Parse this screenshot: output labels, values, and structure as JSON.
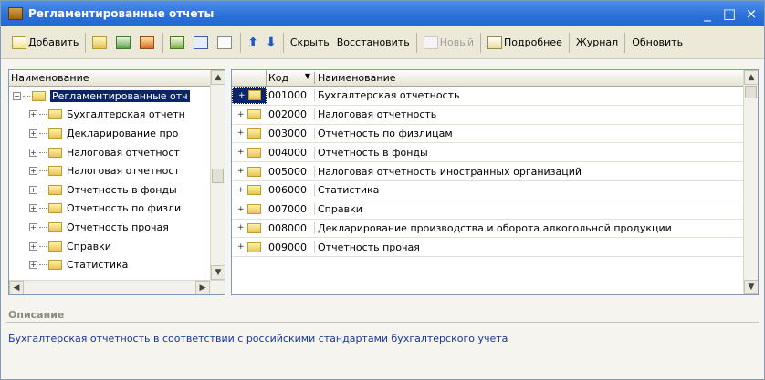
{
  "window": {
    "title": "Регламентированные отчеты",
    "min": "_",
    "max": "□",
    "close": "×"
  },
  "toolbar": {
    "add": "Добавить",
    "hide": "Скрыть",
    "restore": "Восстановить",
    "new": "Новый",
    "details": "Подробнее",
    "journal": "Журнал",
    "refresh": "Обновить"
  },
  "tree": {
    "header": "Наименование",
    "root": "Регламентированные отч",
    "items": [
      "Бухгалтерская отчетн",
      "Декларирование про",
      "Налоговая отчетност",
      "Налоговая отчетност",
      "Отчетность в фонды",
      "Отчетность по физли",
      "Отчетность прочая",
      "Справки",
      "Статистика"
    ]
  },
  "grid": {
    "col_code": "Код",
    "col_name": "Наименование",
    "rows": [
      {
        "code": "001000",
        "name": "Бухгалтерская отчетность"
      },
      {
        "code": "002000",
        "name": "Налоговая отчетность"
      },
      {
        "code": "003000",
        "name": "Отчетность по физлицам"
      },
      {
        "code": "004000",
        "name": "Отчетность в фонды"
      },
      {
        "code": "005000",
        "name": "Налоговая отчетность иностранных организаций"
      },
      {
        "code": "006000",
        "name": "Статистика"
      },
      {
        "code": "007000",
        "name": "Справки"
      },
      {
        "code": "008000",
        "name": "Декларирование производства и оборота алкогольной продукции"
      },
      {
        "code": "009000",
        "name": "Отчетность прочая"
      }
    ]
  },
  "description": {
    "title": "Описание",
    "text": "Бухгалтерская отчетность в соответствии с российскими стандартами бухгалтерского учета"
  }
}
